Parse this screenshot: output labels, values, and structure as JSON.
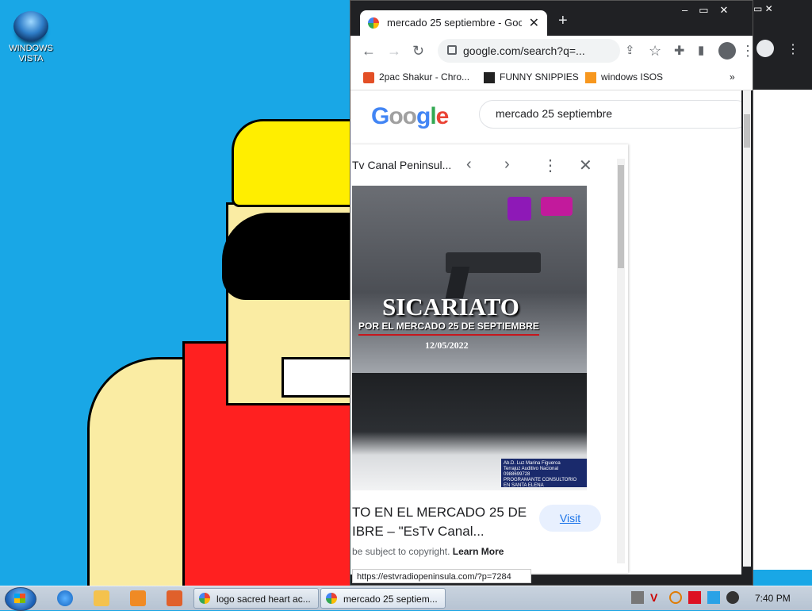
{
  "desktop": {
    "icon_label": "WINDOWS\nVISTA"
  },
  "browser": {
    "tab_title": "mercado 25 septiembre - Google",
    "url": "google.com/search?q=...",
    "bookmarks": [
      {
        "label": "2pac Shakur - Chro...",
        "icon": "page-icon"
      },
      {
        "label": "FUNNY SNIPPIES",
        "icon": "h-icon"
      },
      {
        "label": "windows ISOS",
        "icon": "ph-icon"
      }
    ],
    "more_bookmarks": "»"
  },
  "google": {
    "logo": "Google",
    "search_query": "mercado 25 septiembre"
  },
  "panel": {
    "source_title": "Tv Canal Peninsul...",
    "poster": {
      "headline": "SICARIATO",
      "subline": "POR EL MERCADO 25 DE SEPTIEMBRE",
      "date": "12/05/2022",
      "card_text": "Ab.D. Luz Marina Figueroa\nTerrajuz Auditivo Nacional\n0988699728\nPROGRAMANTE CONSULTORIO EN SANTA ELENA"
    },
    "result_title": "TO EN EL MERCADO 25 DE\nIBRE – \"EsTv Canal...",
    "visit_label": "Visit",
    "copyright_text": "be subject to copyright.",
    "learn_more": "Learn More"
  },
  "status_url": "https://estvradiopeninsula.com/?p=7284",
  "taskbar": {
    "tasks": [
      {
        "label": "logo sacred heart ac..."
      },
      {
        "label": "mercado 25 septiem..."
      }
    ],
    "clock": "7:40 PM"
  },
  "colors": {
    "desktop_bg": "#19a7e6",
    "chrome_dark": "#202124",
    "link_blue": "#1a73e8",
    "cap_yellow": "#ffee00",
    "shirt_red": "#ff2020"
  }
}
